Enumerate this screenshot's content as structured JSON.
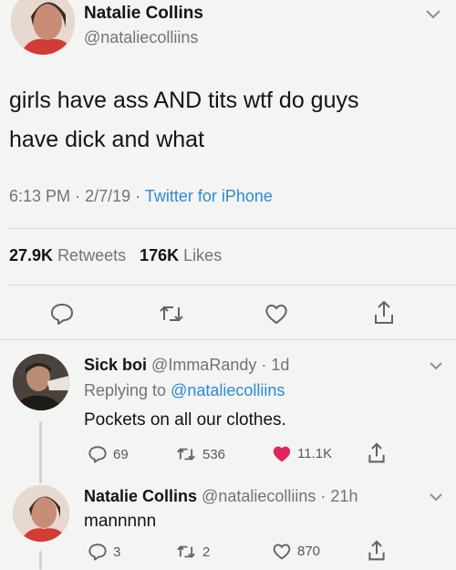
{
  "main_tweet": {
    "name": "Natalie Collins",
    "handle": "@nataliecolliins",
    "text_line1": "girls have ass AND tits wtf do guys",
    "text_line2": "have dick and what",
    "time": "6:13 PM",
    "date": "2/7/19",
    "source": "Twitter for iPhone",
    "retweets_count": "27.9K",
    "retweets_label": "Retweets",
    "likes_count": "176K",
    "likes_label": "Likes",
    "separator": "·"
  },
  "reply1": {
    "name": "Sick boi",
    "handle": "@ImmaRandy",
    "age": "1d",
    "replying_prefix": "Replying to",
    "replying_handle": "@nataliecolliins",
    "text": "Pockets on all our clothes.",
    "replies": "69",
    "retweets": "536",
    "likes": "11.1K"
  },
  "reply2": {
    "name": "Natalie Collins",
    "handle": "@nataliecolliins",
    "age": "21h",
    "text": "mannnnn",
    "replies": "3",
    "retweets": "2",
    "likes": "870"
  },
  "colors": {
    "link": "#2a8ad6",
    "like_active": "#e0245e",
    "muted": "#6f7479"
  },
  "icons": [
    "reply-icon",
    "retweet-icon",
    "heart-icon",
    "share-icon",
    "chevron-down-icon"
  ]
}
